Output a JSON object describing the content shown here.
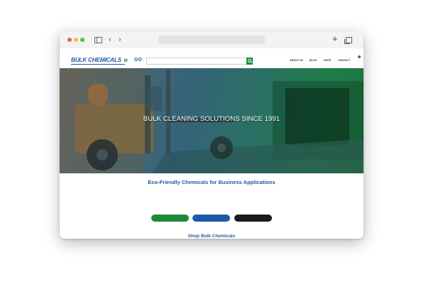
{
  "browser": {
    "url": "",
    "back_glyph": "‹",
    "forward_glyph": "›",
    "new_tab_glyph": "+"
  },
  "topbar": {
    "text": ""
  },
  "header": {
    "logo_text": "BULK CHEMICALS",
    "logo_arrows": "»",
    "logo_suffix": "GO",
    "search_placeholder": "",
    "nav": [
      "ABOUT US",
      "BLOG",
      "SHOP",
      "CONTACT"
    ]
  },
  "hero": {
    "title": "BULK CLEANING SOLUTIONS SINCE 1991"
  },
  "intro": {
    "title": "Eco-Friendly Chemicals for Business Applications",
    "paragraph_lines": [
      "",
      "",
      ""
    ],
    "buttons": [
      "",
      "",
      ""
    ]
  },
  "shop": {
    "title": "Shop Bulk Chemicals"
  },
  "colors": {
    "brand_blue": "#1f5aa8",
    "brand_green": "#1e8a3c",
    "dark": "#1a1a1a"
  },
  "icons": [
    "sidebar-icon",
    "back-icon",
    "forward-icon",
    "new-tab-icon",
    "tabs-icon",
    "search-icon",
    "cart-icon"
  ]
}
